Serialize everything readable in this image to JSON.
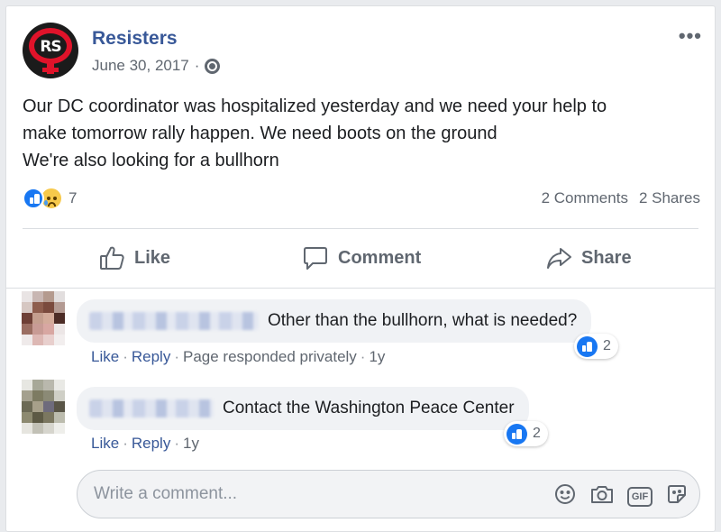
{
  "post": {
    "author": "Resisters",
    "date": "June 30, 2017",
    "date_separator": "·",
    "privacy_icon": "globe-icon",
    "avatar_text": "RS",
    "more_label": "•••",
    "text_lines": [
      "Our DC coordinator was hospitalized yesterday and we need your help to",
      "make tomorrow rally happen. We need boots on the ground",
      "We're also looking for a bullhorn"
    ],
    "reaction_count": "7",
    "comments_count": "2 Comments",
    "shares_count": "2 Shares"
  },
  "actions": {
    "like": "Like",
    "comment": "Comment",
    "share": "Share"
  },
  "comments": [
    {
      "text": "Other than the bullhorn, what is needed?",
      "like": "Like",
      "reply": "Reply",
      "extra": "Page responded privately",
      "time": "1y",
      "reactions": "2"
    },
    {
      "text": "Contact the Washington Peace Center",
      "like": "Like",
      "reply": "Reply",
      "time": "1y",
      "reactions": "2"
    }
  ],
  "composer": {
    "placeholder": "Write a comment...",
    "tools": [
      "emoji-icon",
      "camera-icon",
      "gif-icon",
      "sticker-icon"
    ],
    "gif_label": "GIF"
  },
  "colors": {
    "link": "#385898",
    "like_blue": "#1877f2",
    "muted": "#606770",
    "bubble": "#f0f2f5"
  }
}
